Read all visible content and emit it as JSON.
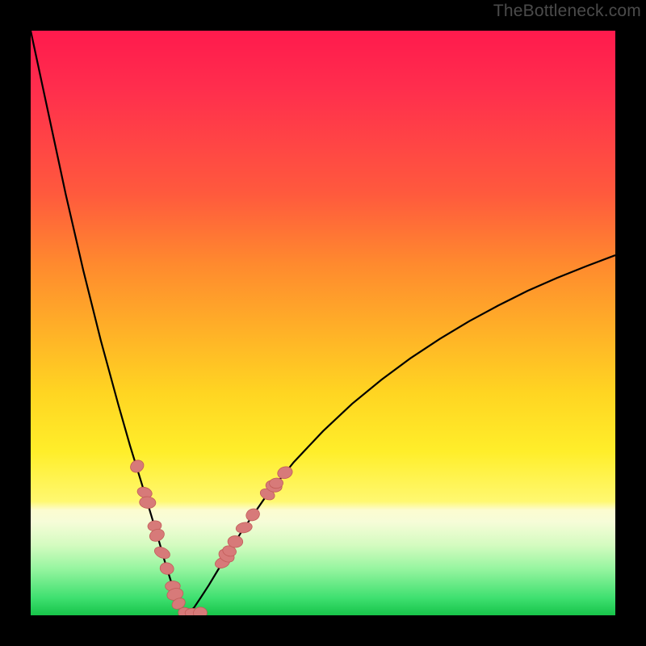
{
  "watermark": "TheBottleneck.com",
  "colors": {
    "marker_fill": "#d77a79",
    "marker_stroke": "#c25c59",
    "curve": "#000000"
  },
  "chart_data": {
    "type": "line",
    "title": "",
    "xlabel": "",
    "ylabel": "",
    "xlim": [
      0,
      100
    ],
    "ylim": [
      0,
      100
    ],
    "x_optimum": 26.5,
    "curve_notes": "V-shaped bottleneck curve; y≈100 at x=0, y≈0 near x≈26.5, rising toward y≈66 at x=100 with concave-down growth on the right side.",
    "series": [
      {
        "name": "bottleneck-curve-left",
        "x": [
          0,
          3,
          6,
          9,
          12,
          15,
          17,
          19,
          20.5,
          22,
          23,
          24,
          24.8,
          25.5,
          26,
          26.5
        ],
        "values": [
          100,
          86,
          72,
          59,
          47,
          36,
          29,
          22.5,
          17.5,
          12.5,
          9,
          5.8,
          3.3,
          1.6,
          0.5,
          0
        ]
      },
      {
        "name": "bottleneck-curve-right",
        "x": [
          26.5,
          27,
          28,
          29,
          30.5,
          32,
          34,
          36,
          40,
          45,
          50,
          55,
          60,
          65,
          70,
          75,
          80,
          85,
          90,
          95,
          100
        ],
        "values": [
          0,
          0.4,
          1.4,
          2.9,
          5.2,
          7.7,
          11,
          14.2,
          20,
          26.2,
          31.5,
          36.2,
          40.3,
          44,
          47.3,
          50.3,
          53,
          55.5,
          57.7,
          59.7,
          61.6
        ]
      }
    ],
    "markers": [
      {
        "x": 18.2,
        "y": 25.5
      },
      {
        "x": 19.5,
        "y": 21.0
      },
      {
        "x": 20.0,
        "y": 19.3
      },
      {
        "x": 21.2,
        "y": 15.3
      },
      {
        "x": 21.6,
        "y": 13.7
      },
      {
        "x": 22.5,
        "y": 10.7
      },
      {
        "x": 23.3,
        "y": 8.0
      },
      {
        "x": 24.3,
        "y": 5.0
      },
      {
        "x": 24.7,
        "y": 3.6
      },
      {
        "x": 25.3,
        "y": 2.0
      },
      {
        "x": 26.5,
        "y": 0.3
      },
      {
        "x": 27.8,
        "y": 0.3
      },
      {
        "x": 29.0,
        "y": 0.4
      },
      {
        "x": 32.8,
        "y": 9.0
      },
      {
        "x": 33.5,
        "y": 10.2
      },
      {
        "x": 34.0,
        "y": 11.0
      },
      {
        "x": 35.0,
        "y": 12.6
      },
      {
        "x": 36.5,
        "y": 15.0
      },
      {
        "x": 38.0,
        "y": 17.2
      },
      {
        "x": 40.5,
        "y": 20.7
      },
      {
        "x": 41.6,
        "y": 22.1
      },
      {
        "x": 42.0,
        "y": 22.6
      },
      {
        "x": 43.5,
        "y": 24.4
      }
    ]
  }
}
